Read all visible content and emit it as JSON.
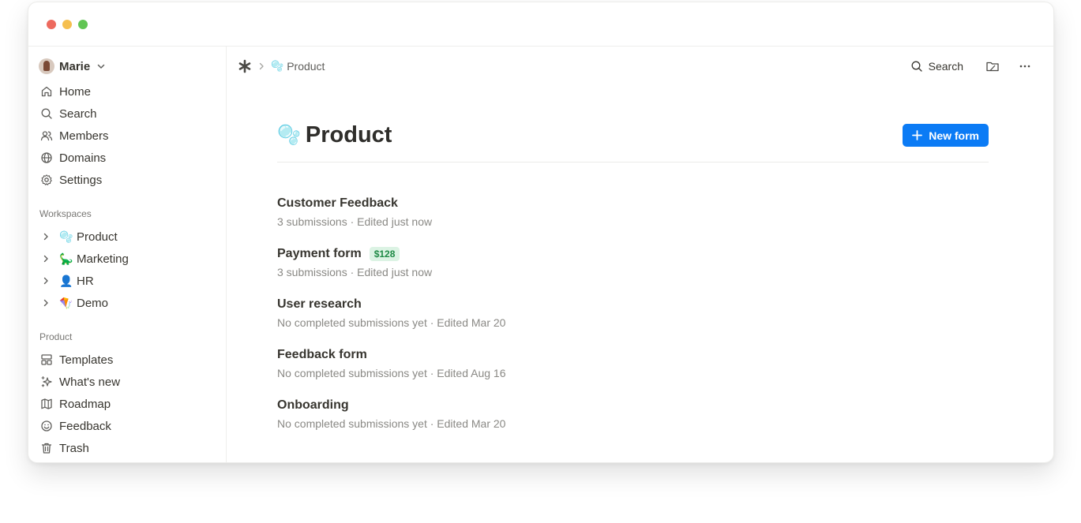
{
  "user": {
    "name": "Marie"
  },
  "nav": [
    {
      "label": "Home",
      "icon": "home-icon"
    },
    {
      "label": "Search",
      "icon": "search-icon"
    },
    {
      "label": "Members",
      "icon": "members-icon"
    },
    {
      "label": "Domains",
      "icon": "globe-icon"
    },
    {
      "label": "Settings",
      "icon": "gear-icon"
    }
  ],
  "workspaces": {
    "heading": "Workspaces",
    "items": [
      {
        "label": "Product",
        "emoji": "🫧"
      },
      {
        "label": "Marketing",
        "emoji": "🦕"
      },
      {
        "label": "HR",
        "emoji": "👤"
      },
      {
        "label": "Demo",
        "emoji": "🪁"
      }
    ]
  },
  "product_section": {
    "heading": "Product",
    "items": [
      {
        "label": "Templates",
        "icon": "templates-icon"
      },
      {
        "label": "What's new",
        "icon": "sparkles-icon"
      },
      {
        "label": "Roadmap",
        "icon": "map-icon"
      },
      {
        "label": "Feedback",
        "icon": "smiley-icon"
      },
      {
        "label": "Trash",
        "icon": "trash-icon"
      }
    ]
  },
  "breadcrumb": {
    "workspace": "Product",
    "emoji": "🫧"
  },
  "topbar": {
    "search_label": "Search"
  },
  "page": {
    "title": "Product",
    "emoji": "🫧",
    "new_form_label": "New form",
    "accent": "#0b7bf5"
  },
  "forms": [
    {
      "title": "Customer Feedback",
      "meta": "3 submissions · Edited just now",
      "badge": ""
    },
    {
      "title": "Payment form",
      "meta": "3 submissions · Edited just now",
      "badge": "$128"
    },
    {
      "title": "User research",
      "meta": "No completed submissions yet · Edited Mar 20",
      "badge": ""
    },
    {
      "title": "Feedback form",
      "meta": "No completed submissions yet · Edited Aug 16",
      "badge": ""
    },
    {
      "title": "Onboarding",
      "meta": "No completed submissions yet · Edited Mar 20",
      "badge": ""
    }
  ]
}
